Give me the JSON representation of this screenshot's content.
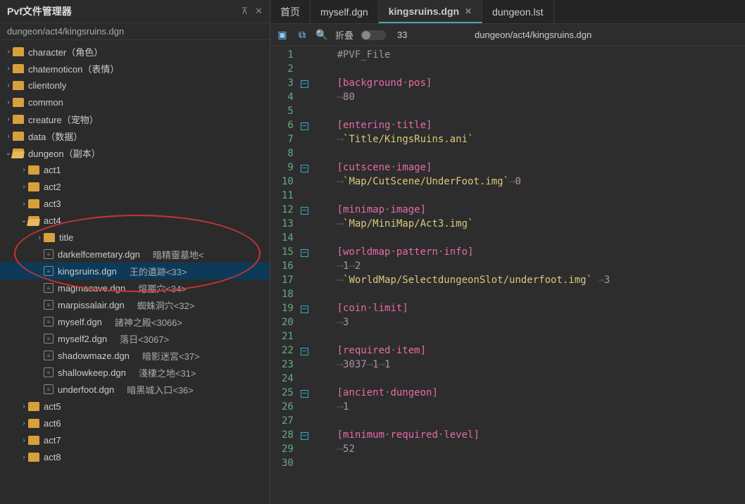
{
  "sidebar": {
    "title": "Pvf文件管理器",
    "path": "dungeon/act4/kingsruins.dgn",
    "tree": [
      {
        "depth": 0,
        "arrow": "›",
        "kind": "folder",
        "label": "character（角色）"
      },
      {
        "depth": 0,
        "arrow": "›",
        "kind": "folder",
        "label": "chatemoticon（表情）"
      },
      {
        "depth": 0,
        "arrow": "›",
        "kind": "folder",
        "label": "clientonly"
      },
      {
        "depth": 0,
        "arrow": "›",
        "kind": "folder",
        "label": "common"
      },
      {
        "depth": 0,
        "arrow": "›",
        "kind": "folder",
        "label": "creature（宠物）"
      },
      {
        "depth": 0,
        "arrow": "›",
        "kind": "folder",
        "label": "data（数据）"
      },
      {
        "depth": 0,
        "arrow": "⌄",
        "kind": "folder-open",
        "label": "dungeon（副本）"
      },
      {
        "depth": 1,
        "arrow": "›",
        "kind": "folder",
        "label": "act1"
      },
      {
        "depth": 1,
        "arrow": "›",
        "kind": "folder",
        "label": "act2"
      },
      {
        "depth": 1,
        "arrow": "›",
        "kind": "folder",
        "label": "act3"
      },
      {
        "depth": 1,
        "arrow": "⌄",
        "kind": "folder-open",
        "label": "act4"
      },
      {
        "depth": 2,
        "arrow": "›",
        "kind": "folder",
        "label": "title"
      },
      {
        "depth": 2,
        "arrow": "",
        "kind": "file",
        "label": "darkelfcemetary.dgn",
        "desc": "暗精靈墓地<"
      },
      {
        "depth": 2,
        "arrow": "",
        "kind": "file",
        "label": "kingsruins.dgn",
        "desc": "王的遺跡<33>",
        "selected": true
      },
      {
        "depth": 2,
        "arrow": "",
        "kind": "file",
        "label": "magmacave.dgn",
        "desc": "熔巖穴<34>"
      },
      {
        "depth": 2,
        "arrow": "",
        "kind": "file",
        "label": "marpissalair.dgn",
        "desc": "蜘蛛洞穴<32>"
      },
      {
        "depth": 2,
        "arrow": "",
        "kind": "file",
        "label": "myself.dgn",
        "desc": "諸神之殿<3066>"
      },
      {
        "depth": 2,
        "arrow": "",
        "kind": "file",
        "label": "myself2.dgn",
        "desc": "落日<3067>"
      },
      {
        "depth": 2,
        "arrow": "",
        "kind": "file",
        "label": "shadowmaze.dgn",
        "desc": "暗影迷宮<37>"
      },
      {
        "depth": 2,
        "arrow": "",
        "kind": "file",
        "label": "shallowkeep.dgn",
        "desc": "淺棲之地<31>"
      },
      {
        "depth": 2,
        "arrow": "",
        "kind": "file",
        "label": "underfoot.dgn",
        "desc": "暗黑城入口<36>"
      },
      {
        "depth": 1,
        "arrow": "›",
        "kind": "folder",
        "label": "act5"
      },
      {
        "depth": 1,
        "arrow": "›",
        "kind": "folder",
        "label": "act6"
      },
      {
        "depth": 1,
        "arrow": "›",
        "kind": "folder",
        "label": "act7"
      },
      {
        "depth": 1,
        "arrow": "›",
        "kind": "folder",
        "label": "act8"
      }
    ]
  },
  "tabs": [
    {
      "label": "首页",
      "active": false,
      "closable": false
    },
    {
      "label": "myself.dgn",
      "active": false,
      "closable": false
    },
    {
      "label": "kingsruins.dgn",
      "active": true,
      "closable": true
    },
    {
      "label": "dungeon.lst",
      "active": false,
      "closable": false
    }
  ],
  "toolbar": {
    "fold_label": "折叠",
    "field1": "33",
    "field2": "dungeon/act4/kingsruins.dgn"
  },
  "code": [
    {
      "n": 1,
      "fold": "",
      "html": "<span class='c-gray'>#PVF_File</span>"
    },
    {
      "n": 2,
      "fold": "",
      "html": ""
    },
    {
      "n": 3,
      "fold": "-",
      "html": "<span class='c-pink'>[background</span><span class='dot'>·</span><span class='c-pink'>pos]</span>"
    },
    {
      "n": 4,
      "fold": "",
      "html": "<span class='arrow-sym'>⟶</span><span class='c-purple'>80</span>"
    },
    {
      "n": 5,
      "fold": "",
      "html": ""
    },
    {
      "n": 6,
      "fold": "-",
      "html": "<span class='c-pink'>[entering</span><span class='dot'>·</span><span class='c-pink'>title]</span>"
    },
    {
      "n": 7,
      "fold": "",
      "html": "<span class='arrow-sym'>⟶</span><span class='c-yellow'>`Title/KingsRuins.ani`</span>"
    },
    {
      "n": 8,
      "fold": "",
      "html": ""
    },
    {
      "n": 9,
      "fold": "-",
      "html": "<span class='c-pink'>[cutscene</span><span class='dot'>·</span><span class='c-pink'>image]</span>"
    },
    {
      "n": 10,
      "fold": "",
      "html": "<span class='arrow-sym'>⟶</span><span class='c-yellow'>`Map/CutScene/UnderFoot.img`</span><span class='arrow-sym'>⟶</span><span class='c-purple'>0</span>"
    },
    {
      "n": 11,
      "fold": "",
      "html": ""
    },
    {
      "n": 12,
      "fold": "-",
      "html": "<span class='c-pink'>[minimap</span><span class='dot'>·</span><span class='c-pink'>image]</span>"
    },
    {
      "n": 13,
      "fold": "",
      "html": "<span class='arrow-sym'>⟶</span><span class='c-yellow'>`Map/MiniMap/Act3.img`</span>"
    },
    {
      "n": 14,
      "fold": "",
      "html": ""
    },
    {
      "n": 15,
      "fold": "-",
      "html": "<span class='c-pink'>[worldmap</span><span class='dot'>·</span><span class='c-pink'>pattern</span><span class='dot'>·</span><span class='c-pink'>info]</span>"
    },
    {
      "n": 16,
      "fold": "",
      "html": "<span class='arrow-sym'>⟶</span><span class='c-purple'>1</span><span class='arrow-sym'>⟶</span><span class='c-purple'>2</span>"
    },
    {
      "n": 17,
      "fold": "",
      "html": "<span class='arrow-sym'>⟶</span><span class='c-yellow'>`WorldMap/SelectdungeonSlot/underfoot.img`</span><span class='arrow-sym'> →</span><span class='c-purple'>3</span>"
    },
    {
      "n": 18,
      "fold": "",
      "html": ""
    },
    {
      "n": 19,
      "fold": "-",
      "html": "<span class='c-pink'>[coin</span><span class='dot'>·</span><span class='c-pink'>limit]</span>"
    },
    {
      "n": 20,
      "fold": "",
      "html": "<span class='arrow-sym'>⟶</span><span class='c-purple'>3</span>"
    },
    {
      "n": 21,
      "fold": "",
      "html": ""
    },
    {
      "n": 22,
      "fold": "-",
      "html": "<span class='c-pink'>[required</span><span class='dot'>·</span><span class='c-pink'>item]</span>"
    },
    {
      "n": 23,
      "fold": "",
      "html": "<span class='arrow-sym'>⟶</span><span class='c-purple'>3037</span><span class='arrow-sym'>⟶</span><span class='c-purple'>1</span><span class='arrow-sym'>⟶</span><span class='c-purple'>1</span>"
    },
    {
      "n": 24,
      "fold": "",
      "html": ""
    },
    {
      "n": 25,
      "fold": "-",
      "html": "<span class='c-pink'>[ancient</span><span class='dot'>·</span><span class='c-pink'>dungeon]</span>"
    },
    {
      "n": 26,
      "fold": "",
      "html": "<span class='arrow-sym'>⟶</span><span class='c-purple'>1</span>"
    },
    {
      "n": 27,
      "fold": "",
      "html": ""
    },
    {
      "n": 28,
      "fold": "-",
      "html": "<span class='c-pink'>[minimum</span><span class='dot'>·</span><span class='c-pink'>required</span><span class='dot'>·</span><span class='c-pink'>level]</span>"
    },
    {
      "n": 29,
      "fold": "",
      "html": "<span class='arrow-sym'>⟶</span><span class='c-purple'>52</span>"
    },
    {
      "n": 30,
      "fold": "",
      "html": ""
    }
  ]
}
